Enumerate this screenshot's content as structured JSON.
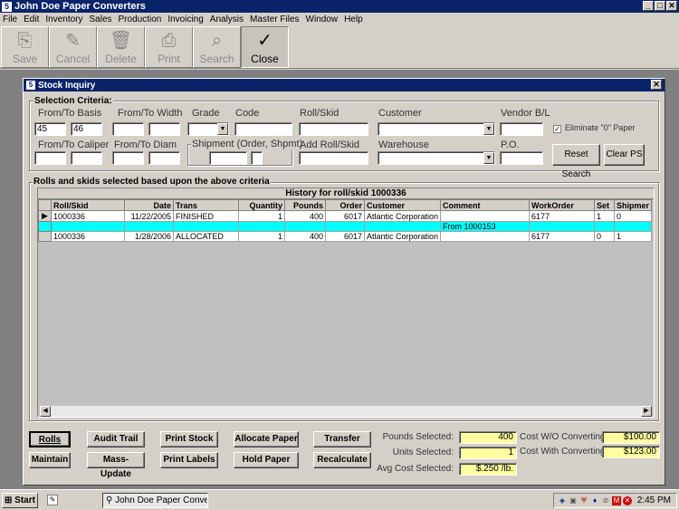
{
  "app": {
    "title": "John Doe Paper Converters",
    "icon": "app-icon"
  },
  "window_buttons": {
    "minimize": "_",
    "maximize": "□",
    "close": "✕"
  },
  "menu": [
    "File",
    "Edit",
    "Inventory",
    "Sales",
    "Production",
    "Invoicing",
    "Analysis",
    "Master Files",
    "Window",
    "Help"
  ],
  "toolbar": {
    "save": "Save",
    "cancel": "Cancel",
    "delete": "Delete",
    "print": "Print",
    "search": "Search",
    "close": "Close"
  },
  "child": {
    "title": "Stock Inquiry",
    "close": "✕"
  },
  "criteria": {
    "legend": "Selection Criteria:",
    "basis_label": "From/To Basis",
    "basis_from": "45",
    "basis_to": "46",
    "width_label": "From/To Width",
    "grade_label": "Grade",
    "code_label": "Code",
    "rollskid_label": "Roll/Skid",
    "customer_label": "Customer",
    "vendor_label": "Vendor B/L",
    "eliminate_label": "Eliminate \"0\" Paper",
    "caliper_label": "From/To Caliper",
    "diam_label": "From/To Diam",
    "shipment_label": "Shipment (Order, Shpmt)",
    "addroll_label": "Add Roll/Skid",
    "warehouse_label": "Warehouse",
    "po_label": "P.O.",
    "reset_search": "Reset Search",
    "clear_ps": "Clear PS"
  },
  "results": {
    "legend": "Rolls and skids selected based upon the above criteria",
    "history_title": "History for roll/skid 1000336",
    "columns": [
      "Roll/Skid",
      "Date",
      "Trans",
      "Quantity",
      "Pounds",
      "Order",
      "Customer",
      "Comment",
      "WorkOrder",
      "Set",
      "Shipmer"
    ],
    "rows": [
      {
        "roll": "1000336",
        "date": "11/22/2005",
        "trans": "FINISHED",
        "qty": "1",
        "pounds": "400",
        "order": "6017",
        "customer": "Atlantic Corporation",
        "comment": "",
        "wo": "6177",
        "set": "1",
        "ship": "0"
      },
      {
        "roll": "",
        "date": "",
        "trans": "",
        "qty": "",
        "pounds": "",
        "order": "",
        "customer": "",
        "comment": "From 1000153",
        "wo": "",
        "set": "",
        "ship": ""
      },
      {
        "roll": "1000336",
        "date": "1/28/2006",
        "trans": "ALLOCATED",
        "qty": "1",
        "pounds": "400",
        "order": "6017",
        "customer": "Atlantic Corporation",
        "comment": "",
        "wo": "6177",
        "set": "0",
        "ship": "1"
      }
    ]
  },
  "buttons": {
    "rolls": "Rolls",
    "audit": "Audit Trail",
    "print_stock": "Print Stock",
    "allocate": "Allocate Paper",
    "transfer": "Transfer",
    "maintain": "Maintain",
    "mass_update": "Mass-Update",
    "print_labels": "Print Labels",
    "hold": "Hold Paper",
    "recalc": "Recalculate"
  },
  "summary": {
    "pounds_label": "Pounds Selected:",
    "pounds": "400",
    "units_label": "Units Selected:",
    "units": "1",
    "avg_label": "Avg Cost Selected:",
    "avg": "$.250 /lb.",
    "wo_label": "Cost W/O Converting:",
    "wo": "$100.00",
    "with_label": "Cost With Converting:",
    "with": "$123.00"
  },
  "taskbar": {
    "start": "Start",
    "task": "John Doe Paper Conve...",
    "clock": "2:45 PM"
  }
}
